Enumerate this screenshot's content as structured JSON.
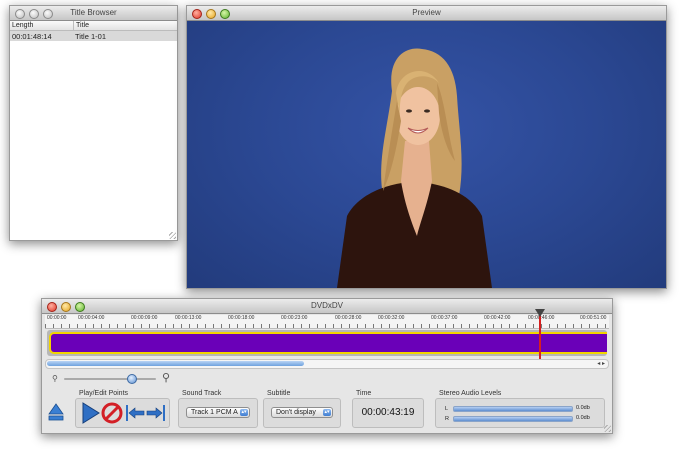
{
  "title_browser": {
    "window_title": "Title Browser",
    "columns": [
      "Length",
      "Title"
    ],
    "rows": [
      {
        "length": "00:01:48:14",
        "title": "Title 1-01"
      }
    ]
  },
  "preview": {
    "window_title": "Preview"
  },
  "main": {
    "window_title": "DVDxDV",
    "timeline_labels": [
      "00:00:00",
      "00:00:04:00",
      "00:00:09:00",
      "00:00:13:00",
      "00:00:18:00",
      "00:00:23:00",
      "00:00:28:00",
      "00:00:32:00",
      "00:00:37:00",
      "00:00:42:00",
      "00:00:46:00",
      "00:00:51:00"
    ],
    "clip_color": "#6a00b8",
    "clip_border_color": "#f2d400",
    "playhead_color": "#d61f1f",
    "groups": {
      "play_edit": "Play/Edit Points",
      "sound_track": "Sound Track",
      "subtitle": "Subtitle",
      "time": "Time",
      "levels": "Stereo Audio Levels"
    },
    "sound_track_value": "Track 1 PCM A",
    "subtitle_value": "Don't display",
    "time_value": "00:00:43:19",
    "levels": {
      "left_label": "L",
      "right_label": "R",
      "left_value": "0.0db",
      "right_value": "0.0db"
    },
    "icons": [
      "eject-icon",
      "play-icon",
      "stop-icon",
      "set-in-point-icon",
      "set-out-point-icon",
      "zoom-out-icon",
      "zoom-in-icon"
    ]
  }
}
